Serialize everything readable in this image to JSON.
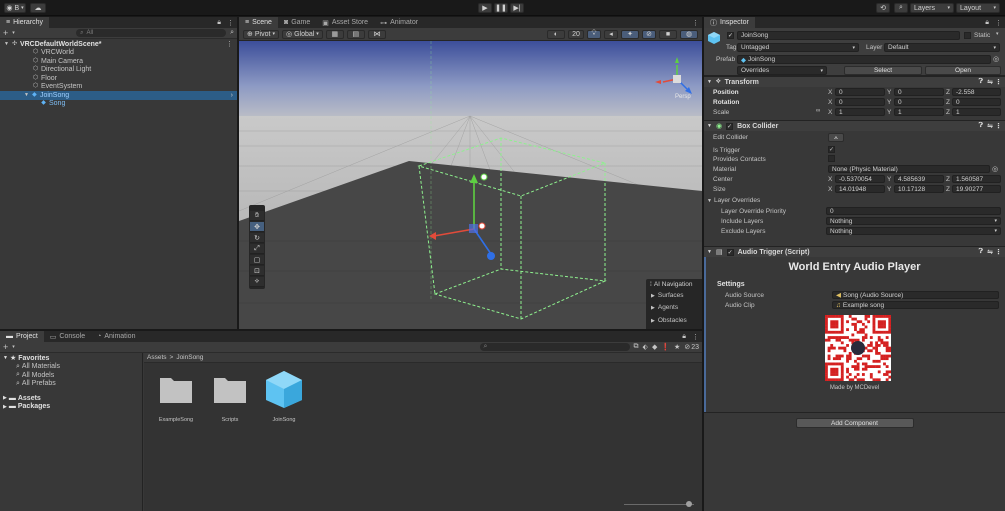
{
  "colors": {
    "accent": "#3a79bb",
    "selected_row": "#2c5d87",
    "link_blue": "#4c9bf5",
    "collider_green": "#8ef08e"
  },
  "toolbar": {
    "account_label": "B",
    "layers_label": "Layers",
    "layout_label": "Layout"
  },
  "hierarchy": {
    "tab_label": "Hierarchy",
    "search_placeholder": "All",
    "scene_name": "VRCDefaultWorldScene*",
    "items": [
      {
        "label": "VRCWorld"
      },
      {
        "label": "Main Camera"
      },
      {
        "label": "Directional Light"
      },
      {
        "label": "Floor"
      },
      {
        "label": "EventSystem"
      },
      {
        "label": "JoinSong"
      },
      {
        "label": "Song"
      }
    ]
  },
  "scene_tabs": [
    {
      "label": "Scene"
    },
    {
      "label": "Game"
    },
    {
      "label": "Asset Store"
    },
    {
      "label": "Animator"
    }
  ],
  "scene_toolbar": {
    "pivot": "Pivot",
    "global": "Global",
    "zoom_value": "20"
  },
  "ai_nav": {
    "title": "AI Navigation",
    "items": [
      {
        "label": "Surfaces"
      },
      {
        "label": "Agents"
      },
      {
        "label": "Obstacles"
      }
    ]
  },
  "gizmo": {
    "persp_label": "Persp"
  },
  "bottom_tabs": [
    {
      "label": "Project"
    },
    {
      "label": "Console"
    },
    {
      "label": "Animation"
    }
  ],
  "project": {
    "favorites_label": "Favorites",
    "favorites": [
      {
        "label": "All Materials"
      },
      {
        "label": "All Models"
      },
      {
        "label": "All Prefabs"
      }
    ],
    "roots": [
      {
        "label": "Assets"
      },
      {
        "label": "Packages"
      }
    ],
    "breadcrumb_root": "Assets",
    "breadcrumb_sep": ">",
    "breadcrumb_current": "JoinSong",
    "hidden_count": "23",
    "assets": [
      {
        "label": "ExampleSong"
      },
      {
        "label": "Scripts"
      },
      {
        "label": "JoinSong"
      }
    ]
  },
  "inspector": {
    "tab_label": "Inspector",
    "object_name": "JoinSong",
    "static_label": "Static",
    "tag_label": "Tag",
    "tag_value": "Untagged",
    "layer_label": "Layer",
    "layer_value": "Default",
    "prefab_label": "Prefab",
    "prefab_value": "JoinSong",
    "overrides_label": "Overrides",
    "select_label": "Select",
    "open_label": "Open",
    "transform": {
      "title": "Transform",
      "rows": [
        {
          "label": "Position",
          "x": "0",
          "y": "0",
          "z": "-2.558"
        },
        {
          "label": "Rotation",
          "x": "0",
          "y": "0",
          "z": "0"
        },
        {
          "label": "Scale",
          "x": "1",
          "y": "1",
          "z": "1"
        }
      ]
    },
    "box_collider": {
      "title": "Box Collider",
      "edit_collider": "Edit Collider",
      "is_trigger": "Is Trigger",
      "provides_contacts": "Provides Contacts",
      "material_label": "Material",
      "material_value": "None (Physic Material)",
      "center_label": "Center",
      "center": {
        "x": "-0.5370054",
        "y": "4.585639",
        "z": "1.560587"
      },
      "size_label": "Size",
      "size": {
        "x": "14.01948",
        "y": "10.17128",
        "z": "19.90277"
      },
      "layer_overrides": "Layer Overrides",
      "priority_label": "Layer Override Priority",
      "priority_value": "0",
      "include_label": "Include Layers",
      "include_value": "Nothing",
      "exclude_label": "Exclude Layers",
      "exclude_value": "Nothing"
    },
    "audio_trigger": {
      "title": "Audio Trigger (Script)",
      "heading": "World Entry Audio Player",
      "settings_label": "Settings",
      "source_label": "Audio Source",
      "source_value": "Song (Audio Source)",
      "clip_label": "Audio Clip",
      "clip_value": "Example song",
      "credit": "Made by MCDevel"
    },
    "add_component": "Add Component"
  }
}
